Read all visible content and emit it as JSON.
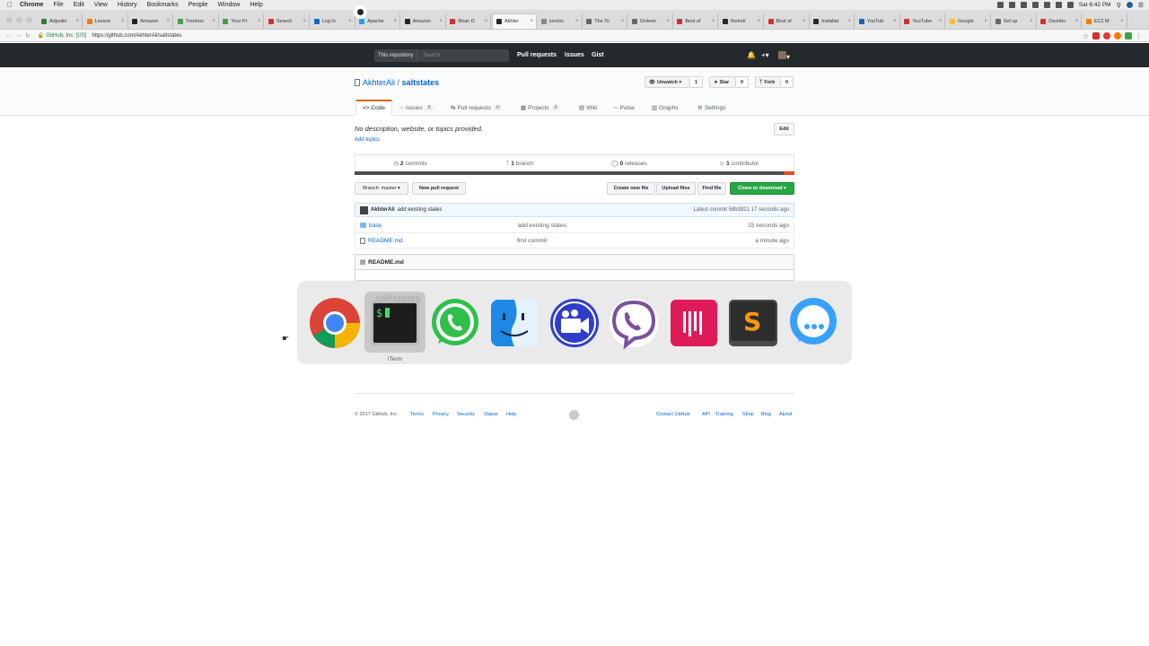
{
  "menubar": {
    "items": [
      "Chrome",
      "File",
      "Edit",
      "View",
      "History",
      "Bookmarks",
      "People",
      "Window",
      "Help"
    ],
    "clock": "Sat 6:42 PM"
  },
  "tabs": [
    {
      "label": "Adjustin",
      "color": "#2e7d32"
    },
    {
      "label": "Lesson",
      "color": "#f57c00"
    },
    {
      "label": "Amazon",
      "color": "#222222"
    },
    {
      "label": "Treehou",
      "color": "#43a047"
    },
    {
      "label": "Your Pr",
      "color": "#43a047"
    },
    {
      "label": "Search",
      "color": "#d32f2f"
    },
    {
      "label": "Log In",
      "color": "#1565c0"
    },
    {
      "label": "Apache",
      "color": "#1da1f2"
    },
    {
      "label": "Amazon",
      "color": "#222222"
    },
    {
      "label": "Brian D",
      "color": "#d32f2f"
    },
    {
      "label": "Akhter",
      "color": "#24292e"
    },
    {
      "label": "centos",
      "color": "#888888"
    },
    {
      "label": "The To",
      "color": "#666666"
    },
    {
      "label": "Orderin",
      "color": "#666666"
    },
    {
      "label": "Best of",
      "color": "#d32f2f"
    },
    {
      "label": "firehol/",
      "color": "#24292e"
    },
    {
      "label": "Best of",
      "color": "#d32f2f"
    },
    {
      "label": "Installat",
      "color": "#24292e"
    },
    {
      "label": "YouTub",
      "color": "#1565c0"
    },
    {
      "label": "YouTube",
      "color": "#d32f2f"
    },
    {
      "label": "Google",
      "color": "#fbc02d"
    },
    {
      "label": "Set up",
      "color": "#666666"
    },
    {
      "label": "Dashbo",
      "color": "#d32f2f"
    },
    {
      "label": "EC2 M",
      "color": "#f57c00"
    }
  ],
  "address": {
    "secure_label": "GitHub, Inc. [US]",
    "url": "https://github.com/AkhterAli/saltstates"
  },
  "gh": {
    "scope": "This repository",
    "search_placeholder": "Search",
    "nav": [
      "Pull requests",
      "Issues",
      "Gist"
    ]
  },
  "repo": {
    "owner": "AkhterAli",
    "sep": "/",
    "name": "saltstates",
    "unwatch": "Unwatch ▾",
    "watch_count": "1",
    "star": "★ Star",
    "star_count": "0",
    "fork": "Fork",
    "fork_count": "0",
    "tabs": [
      {
        "label": "<> Code",
        "count": ""
      },
      {
        "label": "Issues",
        "count": "0"
      },
      {
        "label": "Pull requests",
        "count": "0"
      },
      {
        "label": "Projects",
        "count": "0"
      },
      {
        "label": "Wiki",
        "count": ""
      },
      {
        "label": "Pulse",
        "count": ""
      },
      {
        "label": "Graphs",
        "count": ""
      },
      {
        "label": "Settings",
        "count": ""
      }
    ],
    "description": "No description, website, or topics provided.",
    "add_topics": "Add topics",
    "edit": "Edit",
    "summary": {
      "commits_n": "2",
      "commits_l": "commits",
      "branch_n": "1",
      "branch_l": "branch",
      "releases_n": "0",
      "releases_l": "releases",
      "contrib_n": "1",
      "contrib_l": "contributor"
    },
    "branch_btn": "Branch: master ▾",
    "new_pr": "New pull request",
    "create_file": "Create new file",
    "upload": "Upload files",
    "find": "Find file",
    "clone": "Clone or download ▾",
    "commit": {
      "author": "AkhterAli",
      "message": "add existing states",
      "latest": "Latest commit 58b3921 17 seconds ago"
    },
    "files": [
      {
        "name": "base",
        "message": "add existing states",
        "age": "15 seconds ago",
        "type": "dir"
      },
      {
        "name": "README.md",
        "message": "first commit",
        "age": "a minute ago",
        "type": "file"
      }
    ],
    "readme_title": "README.md"
  },
  "footer": {
    "copyright": "© 2017 GitHub, Inc.",
    "left_links": [
      "Terms",
      "Privacy",
      "Security",
      "Status",
      "Help"
    ],
    "right_links": [
      "Contact GitHub",
      "API",
      "Training",
      "Shop",
      "Blog",
      "About"
    ]
  },
  "switcher": {
    "apps": [
      "Google Chrome",
      "iTerm",
      "WhatsApp",
      "Finder",
      "Screen recorder",
      "Viber",
      "Toggl",
      "Sublime Text",
      "Messages"
    ],
    "selected_label": "iTerm",
    "ghost_text": "saltstates"
  }
}
